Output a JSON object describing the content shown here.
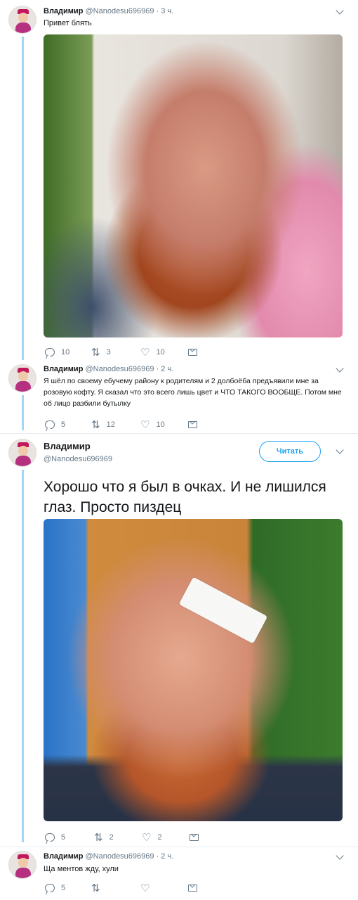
{
  "tweets": [
    {
      "name": "Владимир",
      "handle": "@Nanodesu696969",
      "time": "3 ч.",
      "text": "Привет блять",
      "replies": "10",
      "retweets": "3",
      "likes": "10"
    },
    {
      "name": "Владимир",
      "handle": "@Nanodesu696969",
      "time": "2 ч.",
      "text": "Я шёл по своему ебучему району к родителям и 2 долбоёба предъявили мне за розовую кофту. Я сказал что это всего лишь цвет и ЧТО ТАКОГО ВООБЩЕ. Потом мне об лицо разбили бутылку",
      "replies": "5",
      "retweets": "12",
      "likes": "10"
    },
    {
      "name": "Владимир",
      "handle": "@Nanodesu696969",
      "follow_label": "Читать",
      "text": "Хорошо что я был в очках. И не лишился глаз. Просто пиздец",
      "replies": "5",
      "retweets": "2",
      "likes": "2"
    },
    {
      "name": "Владимир",
      "handle": "@Nanodesu696969",
      "time": "2 ч.",
      "text": "Ща ментов жду, хули",
      "replies": "5"
    }
  ],
  "separator": " · ",
  "icons": [
    "reply-icon",
    "retweet-icon",
    "like-icon",
    "message-icon",
    "chevron-down-icon"
  ],
  "colors": {
    "accent": "#1da1f2",
    "thread": "#a3d7f5",
    "muted": "#657786"
  }
}
